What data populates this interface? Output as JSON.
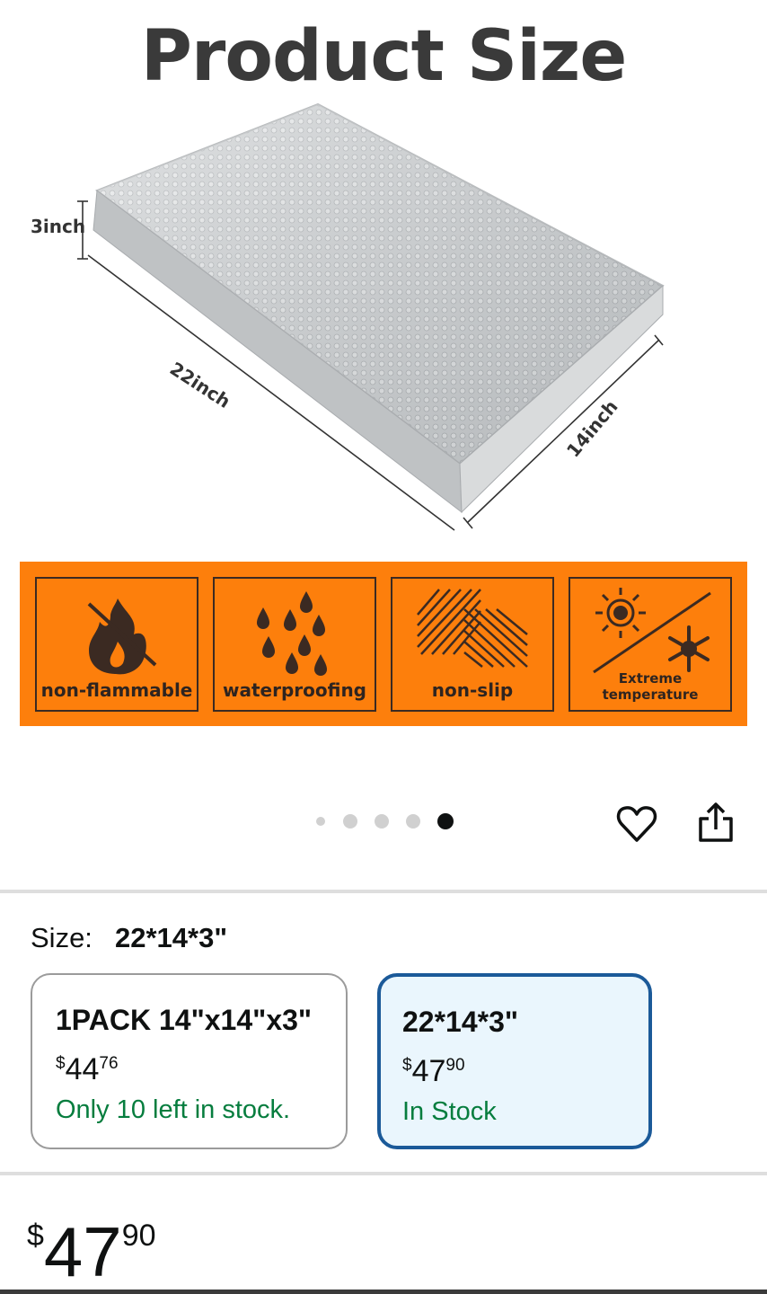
{
  "hero": {
    "title": "Product Size",
    "dimensions": {
      "height": "3inch",
      "length": "22inch",
      "width": "14inch"
    }
  },
  "features": [
    {
      "label": "non-flammable",
      "icon": "no-fire-icon"
    },
    {
      "label": "waterproofing",
      "icon": "water-drops-icon"
    },
    {
      "label": "non-slip",
      "icon": "non-slip-lines-icon"
    },
    {
      "label": "Extreme temperature",
      "icon": "sun-snowflake-icon"
    }
  ],
  "carousel": {
    "total": 5,
    "active": 5
  },
  "size": {
    "label": "Size:",
    "selected": "22*14*3\"",
    "options": [
      {
        "name": "1PACK 14\"x14\"x3\"",
        "currency": "$",
        "price_whole": "44",
        "price_fraction": "76",
        "stock": "Only 10 left in stock.",
        "selected": false
      },
      {
        "name": "22*14*3\"",
        "currency": "$",
        "price_whole": "47",
        "price_fraction": "90",
        "stock": "In Stock",
        "selected": true
      }
    ]
  },
  "price": {
    "currency": "$",
    "whole": "47",
    "fraction": "90"
  },
  "colors": {
    "accent_orange": "#fd7f0c",
    "selected_border": "#1b5a99",
    "in_stock_green": "#067d3e"
  }
}
